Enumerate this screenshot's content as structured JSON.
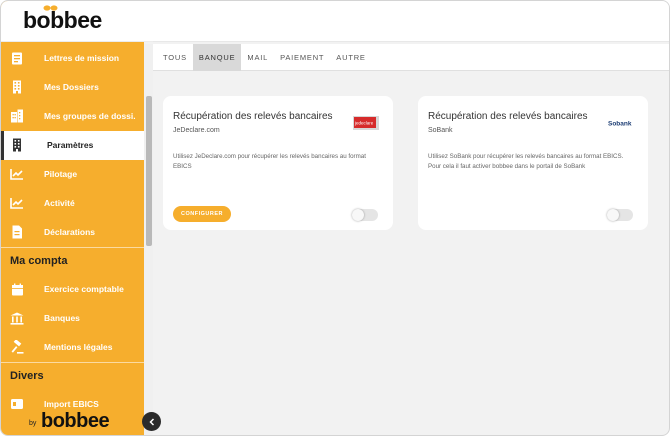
{
  "app": {
    "logo": "bobbee",
    "footer_by": "by",
    "footer_logo": "bobbee"
  },
  "sidebar": {
    "items": [
      {
        "label": "Lettres de mission",
        "icon": "document-icon"
      },
      {
        "label": "Mes Dossiers",
        "icon": "building-icon"
      },
      {
        "label": "Mes groupes de dossi...",
        "icon": "buildings-icon"
      },
      {
        "label": "Paramètres",
        "icon": "building-icon",
        "active": true
      },
      {
        "label": "Pilotage",
        "icon": "chart-line-icon"
      },
      {
        "label": "Activité",
        "icon": "chart-line-icon"
      },
      {
        "label": "Déclarations",
        "icon": "file-icon"
      }
    ],
    "sections": [
      {
        "title": "Ma compta",
        "items": [
          {
            "label": "Exercice comptable",
            "icon": "calendar-icon"
          },
          {
            "label": "Banques",
            "icon": "bank-icon"
          },
          {
            "label": "Mentions légales",
            "icon": "gavel-icon"
          }
        ]
      },
      {
        "title": "Divers",
        "items": [
          {
            "label": "Import EBICS",
            "icon": "import-icon"
          }
        ]
      }
    ]
  },
  "tabs": [
    {
      "label": "TOUS",
      "active": false
    },
    {
      "label": "BANQUE",
      "active": true
    },
    {
      "label": "MAIL",
      "active": false
    },
    {
      "label": "PAIEMENT",
      "active": false
    },
    {
      "label": "AUTRE",
      "active": false
    }
  ],
  "cards": [
    {
      "title": "Récupération des relevés bancaires",
      "provider": "JeDeclare.com",
      "logo_text": "jedeclare",
      "description": "Utilisez JeDeclare.com pour récupérer les relevés bancaires au format EBICS",
      "button": "CONFIGURER",
      "enabled": false
    },
    {
      "title": "Récupération des relevés bancaires",
      "provider": "SoBank",
      "logo_text": "Sobank",
      "description": "Utilisez SoBank pour récupérer les relevés bancaires au format EBICS. Pour cela il faut activer bobbee dans le portail de SoBank",
      "enabled": false
    }
  ],
  "colors": {
    "accent": "#f6ae2d",
    "sidebar_bg": "#f6ae2d",
    "page_bg": "#f2f2f2"
  }
}
